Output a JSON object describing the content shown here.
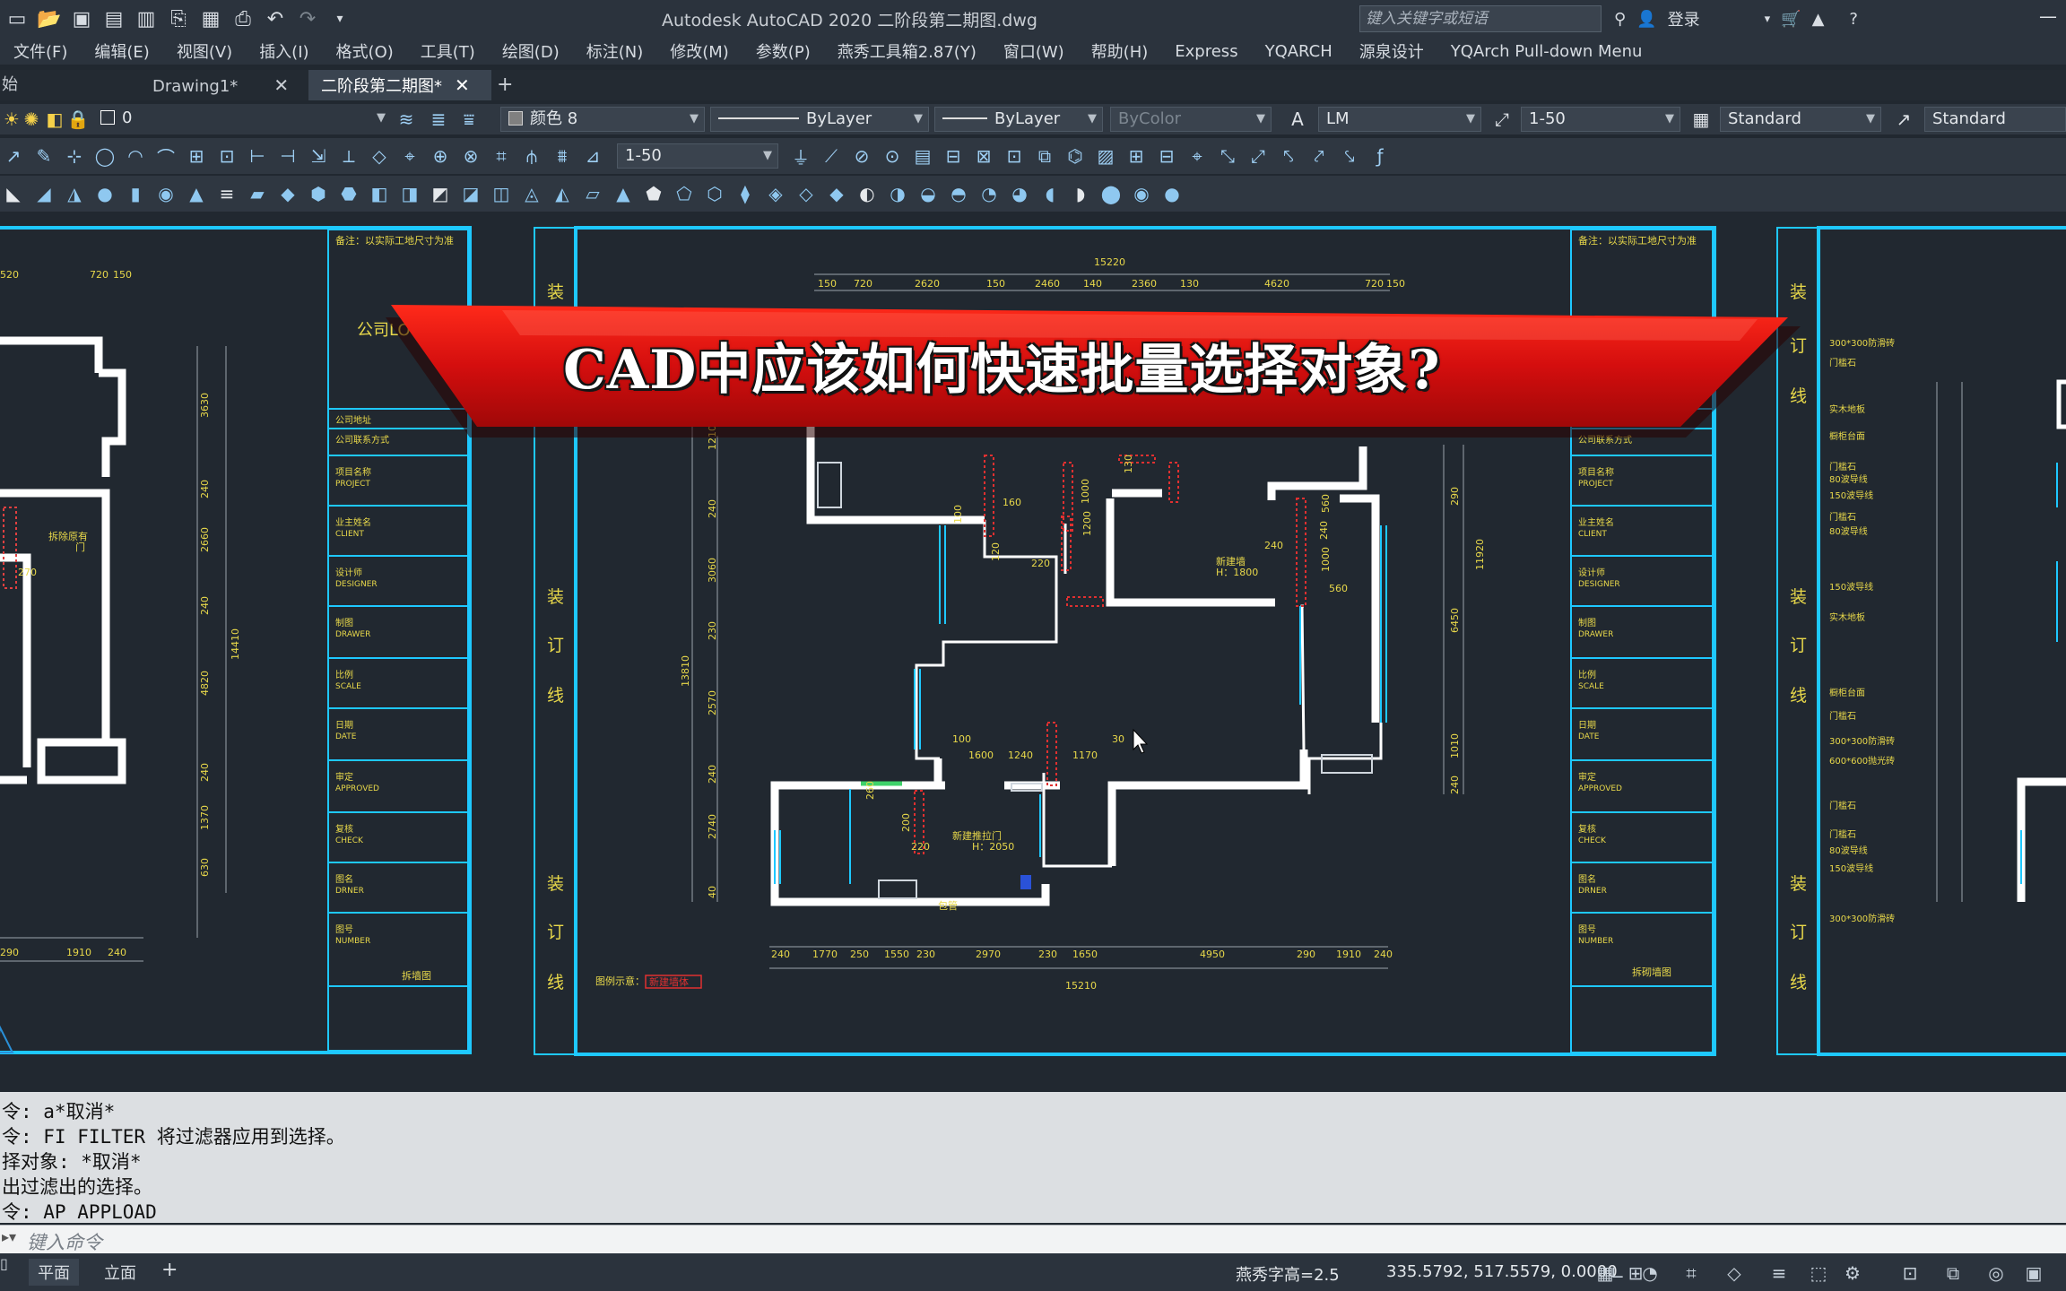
{
  "app": {
    "title": "Autodesk AutoCAD 2020    二阶段第二期图.dwg",
    "search_placeholder": "键入关键字或短语",
    "login_label": "登录"
  },
  "menu": [
    "文件(F)",
    "编辑(E)",
    "视图(V)",
    "插入(I)",
    "格式(O)",
    "工具(T)",
    "绘图(D)",
    "标注(N)",
    "修改(M)",
    "参数(P)",
    "燕秀工具箱2.87(Y)",
    "窗口(W)",
    "帮助(H)",
    "Express",
    "YQARCH",
    "源泉设计",
    "YQArch Pull-down Menu"
  ],
  "tabs": [
    {
      "label": "始",
      "active": false,
      "closable": false
    },
    {
      "label": "Drawing1*",
      "active": false,
      "closable": true
    },
    {
      "label": "二阶段第二期图*",
      "active": true,
      "closable": true
    }
  ],
  "properties": {
    "layer": "0",
    "color": "颜色 8",
    "linetype": "ByLayer",
    "lineweight": "ByLayer",
    "plotstyle": "ByColor",
    "textstyle": "LM",
    "dimscale": "1-50",
    "dimstyle": "Standard",
    "tablestyle": "Standard",
    "annoscale": "1-50"
  },
  "banner": {
    "text": "CAD中应该如何快速批量选择对象?"
  },
  "drawing": {
    "logo_text": "公司LOGO",
    "note_text": "备注：以实际工地尺寸为准",
    "binding_chars": [
      "装",
      "订",
      "线"
    ],
    "title_block_rows": [
      {
        "zh": "公司地址",
        "en": ""
      },
      {
        "zh": "公司联系方式",
        "en": ""
      },
      {
        "zh": "项目名称",
        "en": "PROJECT"
      },
      {
        "zh": "业主姓名",
        "en": "CLIENT"
      },
      {
        "zh": "设计师",
        "en": "DESIGNER"
      },
      {
        "zh": "制图",
        "en": "DRAWER"
      },
      {
        "zh": "比例",
        "en": "SCALE"
      },
      {
        "zh": "日期",
        "en": "DATE"
      },
      {
        "zh": "审定",
        "en": "APPROVED"
      },
      {
        "zh": "复核",
        "en": "CHECK"
      },
      {
        "zh": "图名",
        "en": "DRNER"
      },
      {
        "zh": "图号",
        "en": "NUMBER"
      }
    ],
    "center_drawing_name": "拆砌墙图",
    "left_drawing_name": "拆墙图",
    "room_labels": [
      "新建墙",
      "H：1800",
      "新建推拉门",
      "H：2050",
      "拆除原有门",
      "包管"
    ],
    "top_total_dim": "15220",
    "top_dims": [
      "150",
      "720",
      "2620",
      "150",
      "2460",
      "140",
      "2360",
      "130",
      "4620",
      "720",
      "150"
    ],
    "bottom_total_dim": "15210",
    "bottom_dims": [
      "240",
      "1770",
      "250",
      "1550",
      "230",
      "2970",
      "230",
      "1650",
      "4950",
      "290",
      "1910",
      "240"
    ],
    "left_dims": [
      "1210",
      "240",
      "3060",
      "230",
      "13810",
      "2570",
      "240",
      "2740",
      "40"
    ],
    "right_dims": [
      "290",
      "11920",
      "6450",
      "1010",
      "240"
    ],
    "inner_dims": [
      "1600",
      "1240",
      "1170",
      "100",
      "30",
      "240",
      "220",
      "200",
      "260",
      "100",
      "120",
      "160",
      "1000",
      "1200",
      "130",
      "240",
      "560",
      "1000",
      "560",
      "220"
    ],
    "legend_label": "图例示意：",
    "legend_item": "新建墙体",
    "right_materials": [
      "300*300防滑砖",
      "门槛石",
      "实木地板",
      "橱柜台面",
      "门槛石",
      "80波导线",
      "150波导线",
      "门槛石",
      "80波导线",
      "150波导线",
      "实木地板",
      "橱柜台面",
      "门槛石",
      "300*300防滑砖",
      "600*600抛光砖",
      "门槛石",
      "门槛石",
      "80波导线",
      "150波导线",
      "300*300防滑砖"
    ],
    "left_sheet_dims": [
      "520",
      "720",
      "150",
      "3630",
      "240",
      "2660",
      "240",
      "4820",
      "240",
      "1370",
      "630",
      "14410",
      "290",
      "1910",
      "240",
      "270"
    ]
  },
  "command_history": [
    "令: a*取消*",
    "令: FI FILTER 将过滤器应用到选择。",
    "择对象: *取消*",
    "出过滤出的选择。",
    "令: AP APPLOAD"
  ],
  "command_placeholder": "键入命令",
  "status": {
    "layout_tabs": [
      "平面",
      "立面"
    ],
    "font_height": "燕秀字高=2.5",
    "coordinates": "335.5792, 517.5579, 0.0000"
  },
  "colors": {
    "frame_cyan": "#1ec8ff",
    "banner_red": "#d90f0f",
    "yellow_text": "#e8d84a",
    "wall_white": "#ffffff",
    "bg": "#212830"
  }
}
